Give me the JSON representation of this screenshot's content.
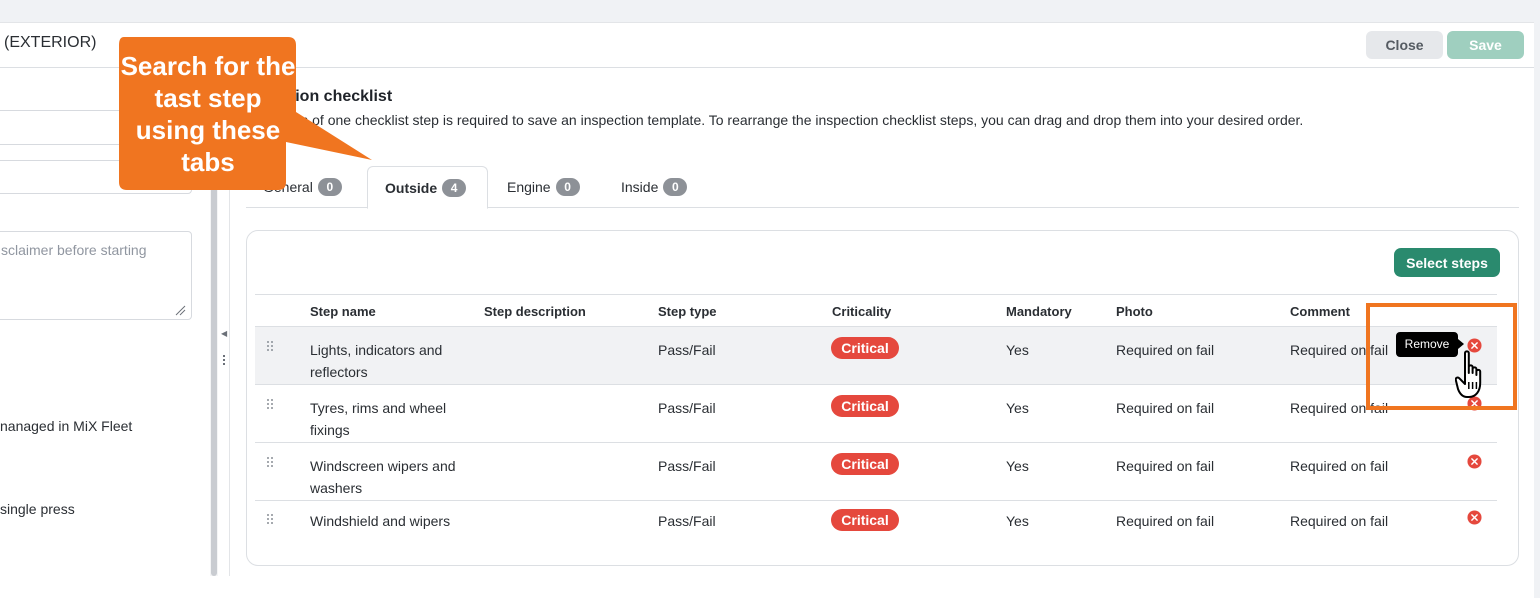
{
  "modal": {
    "title": "(EXTERIOR)",
    "close_label": "Close",
    "save_label": "Save"
  },
  "left_form": {
    "textarea_placeholder": "sclaimer before starting",
    "text_managed": "nanaged in MiX Fleet",
    "text_single_press": "single press"
  },
  "section": {
    "title": "ction checklist",
    "description": "num of one checklist step is required to save an inspection template. To rearrange the inspection checklist steps, you can drag and drop them into your desired order."
  },
  "tabs": [
    {
      "label": "General",
      "count": "0"
    },
    {
      "label": "Outside",
      "count": "4"
    },
    {
      "label": "Engine",
      "count": "0"
    },
    {
      "label": "Inside",
      "count": "0"
    }
  ],
  "select_steps_label": "Select steps",
  "table": {
    "headers": [
      "Step name",
      "Step description",
      "Step type",
      "Criticality",
      "Mandatory",
      "Photo",
      "Comment"
    ],
    "rows": [
      {
        "name": "Lights, indicators and reflectors",
        "description": "",
        "type": "Pass/Fail",
        "criticality": "Critical",
        "mandatory": "Yes",
        "photo": "Required on fail",
        "comment": "Required on fail"
      },
      {
        "name": "Tyres, rims and wheel fixings",
        "description": "",
        "type": "Pass/Fail",
        "criticality": "Critical",
        "mandatory": "Yes",
        "photo": "Required on fail",
        "comment": "Required on fail"
      },
      {
        "name": "Windscreen wipers and washers",
        "description": "",
        "type": "Pass/Fail",
        "criticality": "Critical",
        "mandatory": "Yes",
        "photo": "Required on fail",
        "comment": "Required on fail"
      },
      {
        "name": "Windshield and wipers",
        "description": "",
        "type": "Pass/Fail",
        "criticality": "Critical",
        "mandatory": "Yes",
        "photo": "Required on fail",
        "comment": "Required on fail"
      }
    ]
  },
  "tooltip": "Remove",
  "callout": {
    "text": "Search for the tast step using these tabs"
  },
  "colors": {
    "accent": "#2a8a6e",
    "critical": "#e5483d",
    "callout": "#f07520",
    "save_disabled": "#9fcfbf"
  },
  "icons": [
    "drag-handle-icon",
    "remove-icon",
    "hand-cursor-icon",
    "chevron-down-icon",
    "collapse-arrow-icon"
  ]
}
